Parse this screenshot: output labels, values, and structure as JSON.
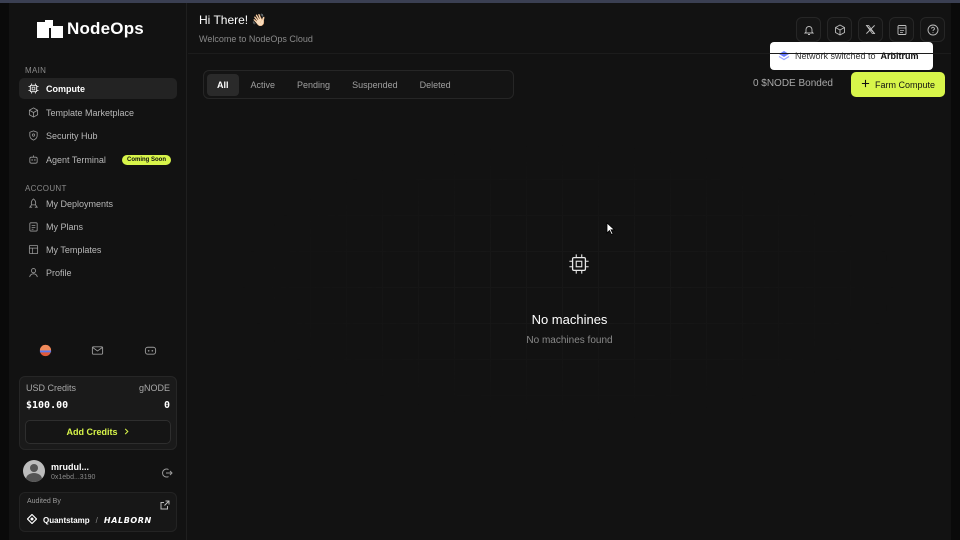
{
  "app": {
    "name": "NodeOps"
  },
  "sidebar": {
    "main_label": "MAIN",
    "account_label": "ACCOUNT",
    "main_items": [
      {
        "label": "Compute",
        "icon": "chip-icon",
        "active": true
      },
      {
        "label": "Template Marketplace",
        "icon": "cube-icon"
      },
      {
        "label": "Security Hub",
        "icon": "shield-icon"
      },
      {
        "label": "Agent Terminal",
        "icon": "robot-icon",
        "badge": "Coming Soon"
      }
    ],
    "account_items": [
      {
        "label": "My Deployments",
        "icon": "rocket-icon"
      },
      {
        "label": "My Plans",
        "icon": "clipboard-icon"
      },
      {
        "label": "My Templates",
        "icon": "template-icon"
      },
      {
        "label": "Profile",
        "icon": "user-icon"
      }
    ],
    "socials": [
      "mirror-icon",
      "mail-icon",
      "discord-icon"
    ],
    "credits": {
      "usd_label": "USD Credits",
      "gnode_label": "gNODE",
      "usd_value": "$100.00",
      "gnode_value": "0",
      "add_label": "Add Credits"
    },
    "user": {
      "name": "mrudul...",
      "address": "0x1ebd...3190"
    },
    "audit": {
      "label": "Audited By",
      "brand1": "Quantstamp",
      "separator": "/",
      "brand2": "HALBORN"
    }
  },
  "header": {
    "greeting": "Hi There! 👋🏻",
    "subtitle": "Welcome to NodeOps Cloud",
    "icons": [
      "bell-icon",
      "box-icon",
      "x-twitter-icon",
      "docs-icon",
      "help-icon"
    ]
  },
  "toast": {
    "prefix": "Network switched to",
    "network": "Arbitrum"
  },
  "tabs": [
    {
      "label": "All",
      "active": true
    },
    {
      "label": "Active"
    },
    {
      "label": "Pending"
    },
    {
      "label": "Suspended"
    },
    {
      "label": "Deleted"
    }
  ],
  "bonded": "0 $NODE Bonded",
  "farm_button": "Farm Compute",
  "empty_state": {
    "title": "No machines",
    "subtitle": "No machines found"
  },
  "colors": {
    "accent": "#d8f54a",
    "background": "#121212"
  }
}
